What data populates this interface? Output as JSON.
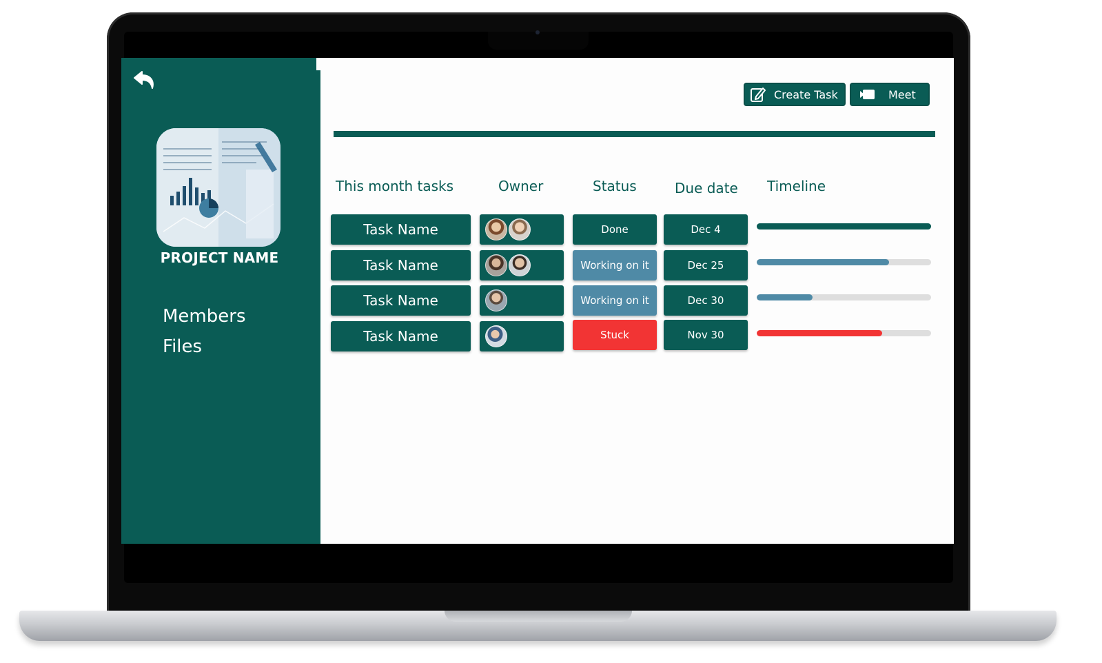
{
  "sidebar": {
    "project_name": "PROJECT NAME",
    "nav": [
      {
        "label": "Members"
      },
      {
        "label": "Files"
      }
    ]
  },
  "toolbar": {
    "create_task_label": "Create Task",
    "meet_label": "Meet"
  },
  "table": {
    "headers": {
      "task": "This month tasks",
      "owner": "Owner",
      "status": "Status",
      "due": "Due date",
      "timeline": "Timeline"
    },
    "rows": [
      {
        "task": "Task Name",
        "owners": 2,
        "status": "Done",
        "status_color": "#0a5c55",
        "due": "Dec 4",
        "progress": 1.0,
        "progress_color": "#0a5c55"
      },
      {
        "task": "Task Name",
        "owners": 2,
        "status": "Working on it",
        "status_color": "#4f8aa6",
        "due": "Dec 25",
        "progress": 0.76,
        "progress_color": "#4f8aa6"
      },
      {
        "task": "Task Name",
        "owners": 1,
        "status": "Working on it",
        "status_color": "#4f8aa6",
        "due": "Dec 30",
        "progress": 0.32,
        "progress_color": "#4f8aa6"
      },
      {
        "task": "Task Name",
        "owners": 1,
        "status": "Stuck",
        "status_color": "#f23434",
        "due": "Nov 30",
        "progress": 0.72,
        "progress_color": "#f23434"
      }
    ]
  },
  "colors": {
    "teal": "#0a5c55",
    "working": "#4f8aa6",
    "stuck": "#f23434",
    "track": "#dedede"
  },
  "icons": [
    "back-arrow-icon",
    "edit-icon",
    "video-camera-icon",
    "avatar"
  ]
}
